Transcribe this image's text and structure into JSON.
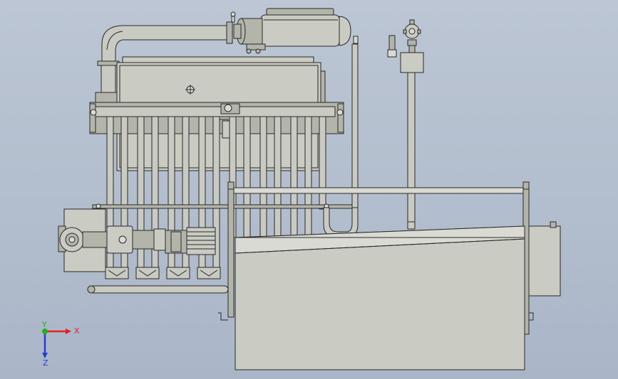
{
  "triad": {
    "x_label": "X",
    "y_label": "Y",
    "z_label": "Z",
    "x_color": "#e02020",
    "y_color": "#20b020",
    "z_color": "#2040d0"
  },
  "colors": {
    "background_top": "#bcc6d4",
    "background_bottom": "#aab6c8",
    "metal": "#cacbc2",
    "outline": "#2a2a2a"
  }
}
